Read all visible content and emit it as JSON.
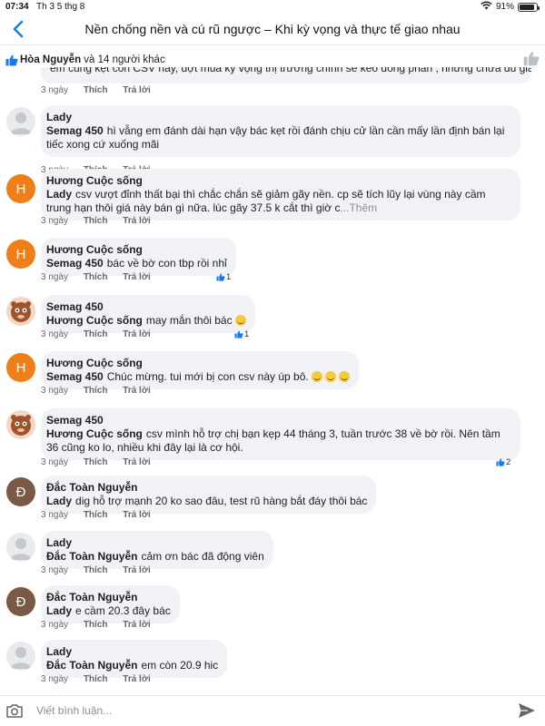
{
  "status": {
    "time": "07:34",
    "date": "Th 3 5 thg 8",
    "battery": "91%",
    "battery_level": 0.91
  },
  "header": {
    "title": "Nền chống nền và cú rũ ngược – Khi kỳ vọng và thực tế giao nhau"
  },
  "reactions": {
    "first_name": "Hòa Nguyễn",
    "others": "và 14 người khác"
  },
  "labels": {
    "like": "Thích",
    "reply": "Trả lời",
    "more": "...Thêm"
  },
  "cropped_comment": {
    "text": "em cũng kẹt con CSV này, đợt mua kỳ vọng thị trường chính sẽ kéo đồng phần , nhưng chưa đủ giá nhịp.",
    "time": "3 ngày"
  },
  "comments": [
    {
      "author": "Lady",
      "avatar": "person",
      "tag": "Semag 450",
      "text": "hì vẫng em đánh dài hạn vậy bác kẹt rồi đánh chịu cử lần cần mấy lần định bán lại tiếc xong cứ xuống mãi",
      "time": "3 ngày"
    },
    {
      "author": "Hương Cuộc sống",
      "avatar": "H",
      "tag": "Lady",
      "text": "csv vượt đỉnh thất bại thì chắc chắn sẽ giảm gãy nền. cp sẽ tích lũy lại vùng này cầm trung hạn thôi giá này bán gì nữa. lúc gãy 37.5 k cắt thì giờ c",
      "time": "3 ngày"
    },
    {
      "author": "Hương Cuộc sống",
      "avatar": "H",
      "tag": "Semag 450",
      "text": "bác về bờ con tbp rồi nhỉ",
      "time": "3 ngày",
      "likes": "1"
    },
    {
      "author": "Semag 450",
      "avatar": "cartoon",
      "tag": "Hương Cuộc sống",
      "text": "may mắn thôi bác",
      "time": "3 ngày",
      "likes": "1"
    },
    {
      "author": "Hương Cuộc sống",
      "avatar": "H",
      "tag": "Semag 450",
      "text": "Chúc mừng. tui mới bị con csv này úp bô.",
      "time": "3 ngày"
    },
    {
      "author": "Semag 450",
      "avatar": "cartoon",
      "tag": "Hương Cuộc sống",
      "text": "csv mình hỗ trợ chị bạn kẹp 44 tháng 3, tuần trước 38 về bờ rồi.  Nên tầm 36 cũng ko lo, nhiều khi đây lại là cơ hội.",
      "time": "3 ngày",
      "likes": "2"
    },
    {
      "author": "Đắc Toàn Nguyễn",
      "avatar": "Đ",
      "tag": "Lady",
      "text": "dig hỗ trợ mạnh 20 ko sao đâu, test rũ hàng bắt đáy thôi bác",
      "time": "3 ngày"
    },
    {
      "author": "Lady",
      "avatar": "person",
      "tag": "Đắc Toàn Nguyễn",
      "text": "cảm ơn bác đã động viên",
      "time": "3 ngày"
    },
    {
      "author": "Đắc Toàn Nguyễn",
      "avatar": "Đ",
      "tag": "Lady",
      "text": "e cầm 20.3 đây bác",
      "time": "3 ngày"
    },
    {
      "author": "Lady",
      "avatar": "person",
      "tag": "Đắc Toàn Nguyễn",
      "text": "em còn 20.9 hic",
      "time": "3 ngày"
    }
  ],
  "composer": {
    "placeholder": "Viết bình luận..."
  },
  "icons": {
    "back": "chevron-left-icon",
    "like": "thumbs-up-icon",
    "camera": "camera-icon",
    "send": "send-icon",
    "wifi": "wifi-icon"
  },
  "colors": {
    "accent": "#1877f2",
    "bubble": "#f0f2f5",
    "avatar_h": "#f07f1a",
    "avatar_d": "#7a5a47"
  }
}
